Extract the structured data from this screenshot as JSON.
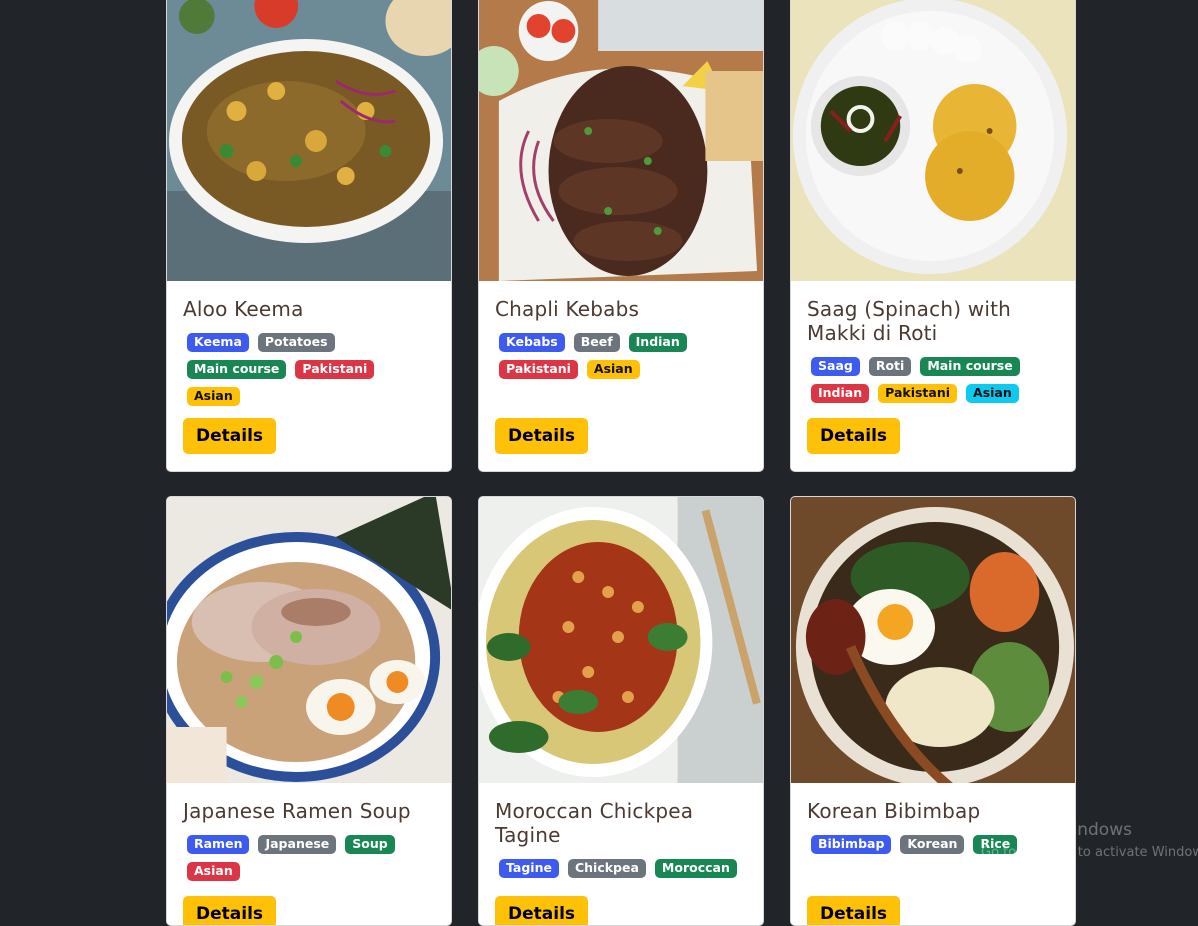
{
  "details_label": "Details",
  "cards": [
    {
      "title": "Aloo Keema",
      "tags": [
        {
          "label": "Keema",
          "color": "#3d5af1"
        },
        {
          "label": "Potatoes",
          "color": "#6c757d"
        },
        {
          "label": "Main course",
          "color": "#198754"
        },
        {
          "label": "Pakistani",
          "color": "#dc3545"
        },
        {
          "label": "Asian",
          "color": "#ffc107"
        }
      ]
    },
    {
      "title": "Chapli Kebabs",
      "tags": [
        {
          "label": "Kebabs",
          "color": "#3d5af1"
        },
        {
          "label": "Beef",
          "color": "#6c757d"
        },
        {
          "label": "Indian",
          "color": "#198754"
        },
        {
          "label": "Pakistani",
          "color": "#dc3545"
        },
        {
          "label": "Asian",
          "color": "#ffc107"
        }
      ]
    },
    {
      "title": "Saag (Spinach) with Makki di Roti",
      "tags": [
        {
          "label": "Saag",
          "color": "#3d5af1"
        },
        {
          "label": "Roti",
          "color": "#6c757d"
        },
        {
          "label": "Main course",
          "color": "#198754"
        },
        {
          "label": "Indian",
          "color": "#dc3545"
        },
        {
          "label": "Pakistani",
          "color": "#ffc107"
        },
        {
          "label": "Asian",
          "color": "#0dcaf0"
        }
      ]
    },
    {
      "title": "Japanese Ramen Soup",
      "tags": [
        {
          "label": "Ramen",
          "color": "#3d5af1"
        },
        {
          "label": "Japanese",
          "color": "#6c757d"
        },
        {
          "label": "Soup",
          "color": "#198754"
        },
        {
          "label": "Asian",
          "color": "#dc3545"
        }
      ]
    },
    {
      "title": "Moroccan Chickpea Tagine",
      "tags": [
        {
          "label": "Tagine",
          "color": "#3d5af1"
        },
        {
          "label": "Chickpea",
          "color": "#6c757d"
        },
        {
          "label": "Moroccan",
          "color": "#198754"
        }
      ]
    },
    {
      "title": "Korean Bibimbap",
      "tags": [
        {
          "label": "Bibimbap",
          "color": "#3d5af1"
        },
        {
          "label": "Korean",
          "color": "#6c757d"
        },
        {
          "label": "Rice",
          "color": "#198754"
        }
      ]
    }
  ],
  "watermark": {
    "line1": "Activate Windows",
    "line2": "Go to Settings to activate Windows."
  }
}
